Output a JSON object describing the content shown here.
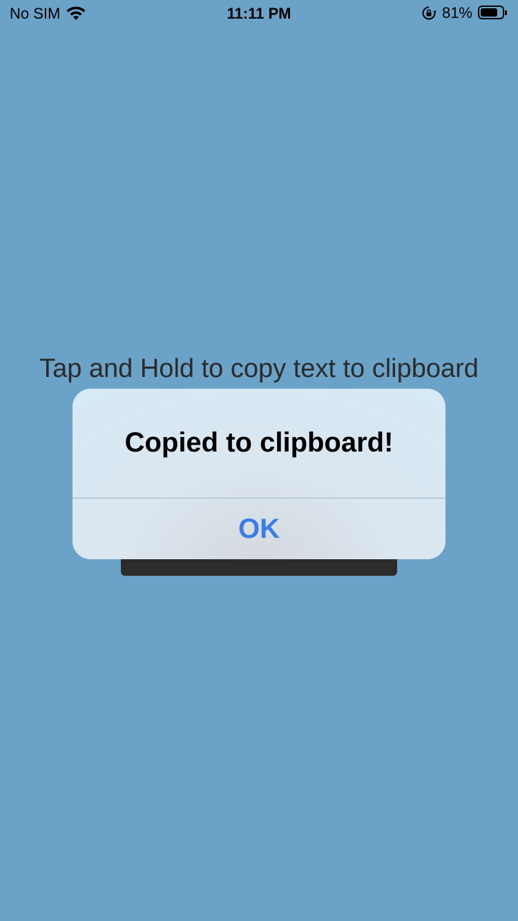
{
  "status_bar": {
    "carrier": "No SIM",
    "time": "11:11 PM",
    "battery_percent": "81%",
    "battery_level": 0.81,
    "icons": [
      "wifi-icon",
      "rotation-lock-icon",
      "battery-icon"
    ]
  },
  "main": {
    "instruction": "Tap and Hold to copy text to clipboard"
  },
  "alert": {
    "title": "Copied to clipboard!",
    "ok_label": "OK"
  },
  "colors": {
    "background": "#6ba2c8",
    "alert_button": "#3a7ce8",
    "dark_panel": "#2c2c2c"
  }
}
